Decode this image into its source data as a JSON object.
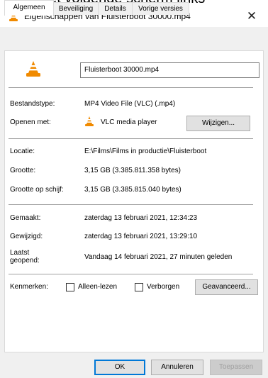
{
  "cut_text": "het volgende scherm links",
  "window": {
    "title": "Eigenschappen van Fluisterboot 30000.mp4",
    "close_glyph": "✕"
  },
  "tabs": [
    "Algemeen",
    "Beveiliging",
    "Details",
    "Vorige versies"
  ],
  "file": {
    "name": "Fluisterboot 30000.mp4"
  },
  "rows": {
    "type_label": "Bestandstype:",
    "type_value": "MP4 Video File (VLC) (.mp4)",
    "open_label": "Openen met:",
    "open_value": "VLC media player",
    "change_button": "Wijzigen...",
    "location_label": "Locatie:",
    "location_value": "E:\\Films\\Films in productie\\Fluisterboot",
    "size_label": "Grootte:",
    "size_value": "3,15 GB (3.385.811.358 bytes)",
    "disk_label": "Grootte op schijf:",
    "disk_value": "3,15 GB (3.385.815.040 bytes)",
    "created_label": "Gemaakt:",
    "created_value": "zaterdag 13 februari 2021, 12:34:23",
    "modified_label": "Gewijzigd:",
    "modified_value": "zaterdag 13 februari 2021, 13:29:10",
    "opened_label_1": "Laatst",
    "opened_label_2": "geopend:",
    "opened_value": "Vandaag 14 februari 2021, 27 minuten geleden",
    "attr_label": "Kenmerken:",
    "readonly_label": "Alleen-lezen",
    "hidden_label": "Verborgen",
    "advanced_button": "Geavanceerd..."
  },
  "footer": {
    "ok": "OK",
    "cancel": "Annuleren",
    "apply": "Toepassen"
  },
  "icons": {
    "vlc": "vlc-cone-icon"
  },
  "colors": {
    "vlc_orange": "#f08a00",
    "focus_blue": "#0078d7"
  }
}
